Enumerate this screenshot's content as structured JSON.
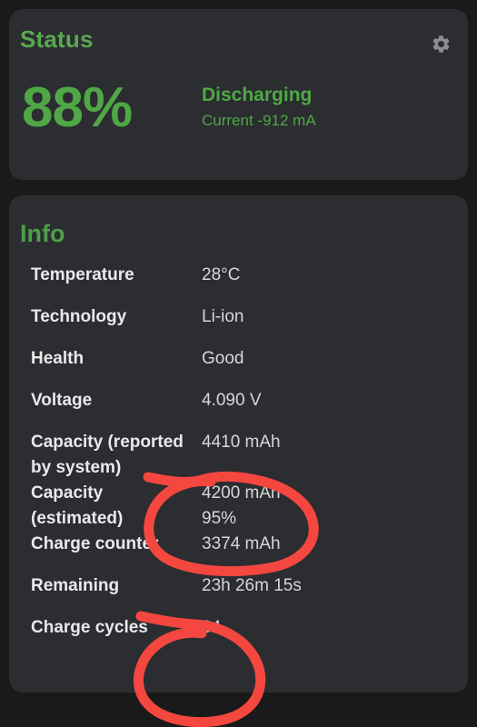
{
  "theme": {
    "page_background": "#1a1a1a",
    "card_background": "#2b2d31",
    "accent_green": "#4fa845",
    "label_color": "#e8e9ea",
    "value_color": "#d5d7d9",
    "annotation_red": "#f4473f"
  },
  "status": {
    "title": "Status",
    "settings_icon": "gear-icon",
    "percent": "88%",
    "state": "Discharging",
    "current": "Current -912 mA"
  },
  "info": {
    "title": "Info",
    "rows": [
      {
        "label": "Temperature",
        "value": "28°C"
      },
      {
        "label": "Technology",
        "value": "Li-ion"
      },
      {
        "label": "Health",
        "value": "Good"
      },
      {
        "label": "Voltage",
        "value": "4.090 V"
      },
      {
        "label": "Capacity (reported by system)",
        "value": "4410 mAh"
      },
      {
        "label": "Capacity (estimated)",
        "value": "4200 mAh\n95%"
      },
      {
        "label": "Charge counter",
        "value": "3374 mAh"
      },
      {
        "label": "Remaining",
        "value": "23h 26m 15s"
      },
      {
        "label": "Charge cycles",
        "value": "34"
      }
    ]
  },
  "annotations": [
    {
      "name": "circle-capacity-estimated",
      "shape": "hand-drawn-ellipse"
    },
    {
      "name": "circle-charge-cycles",
      "shape": "hand-drawn-ellipse"
    }
  ]
}
